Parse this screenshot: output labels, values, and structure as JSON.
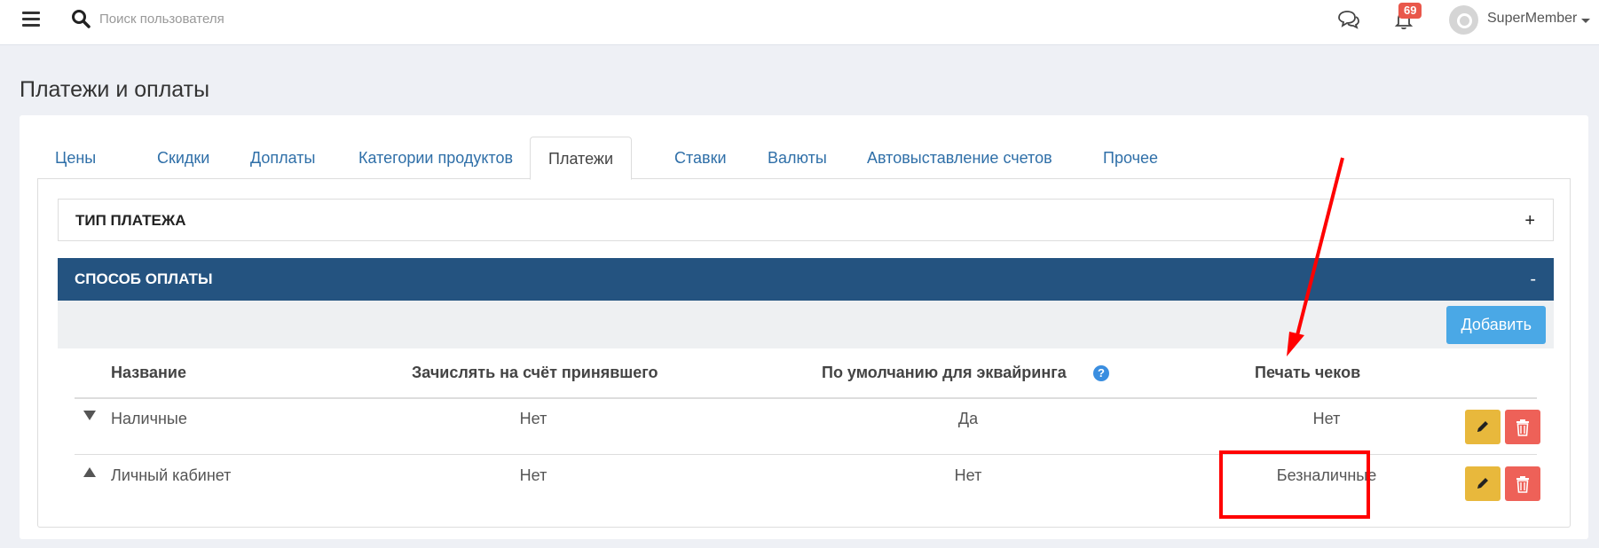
{
  "topbar": {
    "search_placeholder": "Поиск пользователя",
    "notification_count": "69",
    "user_name": "SuperMember"
  },
  "page": {
    "title": "Платежи и оплаты"
  },
  "tabs": [
    {
      "label": "Цены"
    },
    {
      "label": "Скидки"
    },
    {
      "label": "Доплаты"
    },
    {
      "label": "Категории продуктов"
    },
    {
      "label": "Платежи",
      "active": true
    },
    {
      "label": "Ставки"
    },
    {
      "label": "Валюты"
    },
    {
      "label": "Автовыставление счетов"
    },
    {
      "label": "Прочее"
    }
  ],
  "accordion": {
    "payment_type": {
      "title": "ТИП ПЛАТЕЖА",
      "toggle": "+"
    },
    "payment_method": {
      "title": "СПОСОБ ОПЛАТЫ",
      "toggle": "-"
    }
  },
  "toolbar": {
    "add_label": "Добавить"
  },
  "table": {
    "headers": [
      "Название",
      "Зачислять на счёт принявшего",
      "По умолчанию для эквайринга",
      "Печать чеков"
    ],
    "help_glyph": "?",
    "rows": [
      {
        "name": "Наличные",
        "credit_to_receiver": "Нет",
        "default_acquiring": "Да",
        "print_receipts": "Нет",
        "expanded": false
      },
      {
        "name": "Личный кабинет",
        "credit_to_receiver": "Нет",
        "default_acquiring": "Нет",
        "print_receipts": "Безналичные",
        "expanded": true
      }
    ]
  },
  "colors": {
    "accent_header": "#245380",
    "add_button": "#4aa8e6",
    "edit_button": "#e8b83c",
    "delete_button": "#ee6158",
    "annotation": "#ff0000",
    "badge": "#e9574b"
  },
  "icons": {
    "menu": "hamburger-icon",
    "search": "search-icon",
    "chat": "chat-icon",
    "notifications": "bell-icon",
    "edit": "pencil-icon",
    "delete": "trash-icon",
    "help": "question-circle-icon"
  }
}
